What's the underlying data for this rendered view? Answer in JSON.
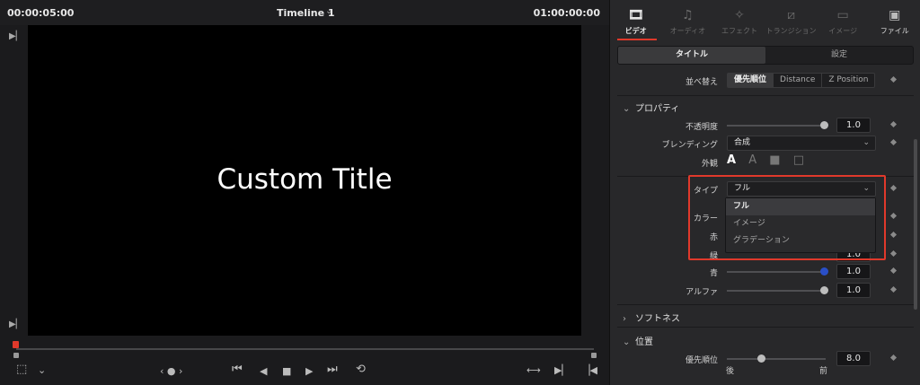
{
  "viewer": {
    "timecode_left": "00:00:05:00",
    "timeline_name": "Timeline 1",
    "timecode_right": "01:00:00:00",
    "title_text": "Custom Title",
    "controls": {
      "nav": "‹ ● ›",
      "first": "⏮",
      "prev": "◀",
      "stop": "■",
      "play": "▶",
      "last": "⏭",
      "loop": "⟲"
    }
  },
  "inspector": {
    "tabs": [
      {
        "label": "ビデオ",
        "icon": "film-icon",
        "active": true
      },
      {
        "label": "オーディオ",
        "icon": "music-note-icon",
        "active": false
      },
      {
        "label": "エフェクト",
        "icon": "magic-wand-icon",
        "active": false
      },
      {
        "label": "トランジション",
        "icon": "transition-icon",
        "active": false
      },
      {
        "label": "イメージ",
        "icon": "image-icon",
        "active": false
      },
      {
        "label": "ファイル",
        "icon": "file-icon",
        "active": false
      }
    ],
    "subtabs": [
      "タイトル",
      "設定"
    ],
    "sort": {
      "label": "並べ替え",
      "options": [
        "優先順位",
        "Distance",
        "Z Position"
      ]
    },
    "properties": {
      "header": "プロパティ",
      "opacity": {
        "label": "不透明度",
        "value": "1.0"
      },
      "blending": {
        "label": "ブレンディング",
        "value": "合成"
      },
      "appearance": {
        "label": "外観"
      },
      "type": {
        "label": "タイプ",
        "value": "フル",
        "options": [
          "フル",
          "イメージ",
          "グラデーション"
        ]
      },
      "color": {
        "label": "カラー"
      },
      "red": {
        "label": "赤"
      },
      "green": {
        "label": "緑",
        "value": "1.0"
      },
      "blue": {
        "label": "青",
        "value": "1.0"
      },
      "alpha": {
        "label": "アルファ",
        "value": "1.0"
      }
    },
    "softness": {
      "header": "ソフトネス"
    },
    "position": {
      "header": "位置",
      "priority": {
        "label": "優先順位",
        "value": "8.0",
        "left": "後",
        "right": "前"
      }
    }
  }
}
